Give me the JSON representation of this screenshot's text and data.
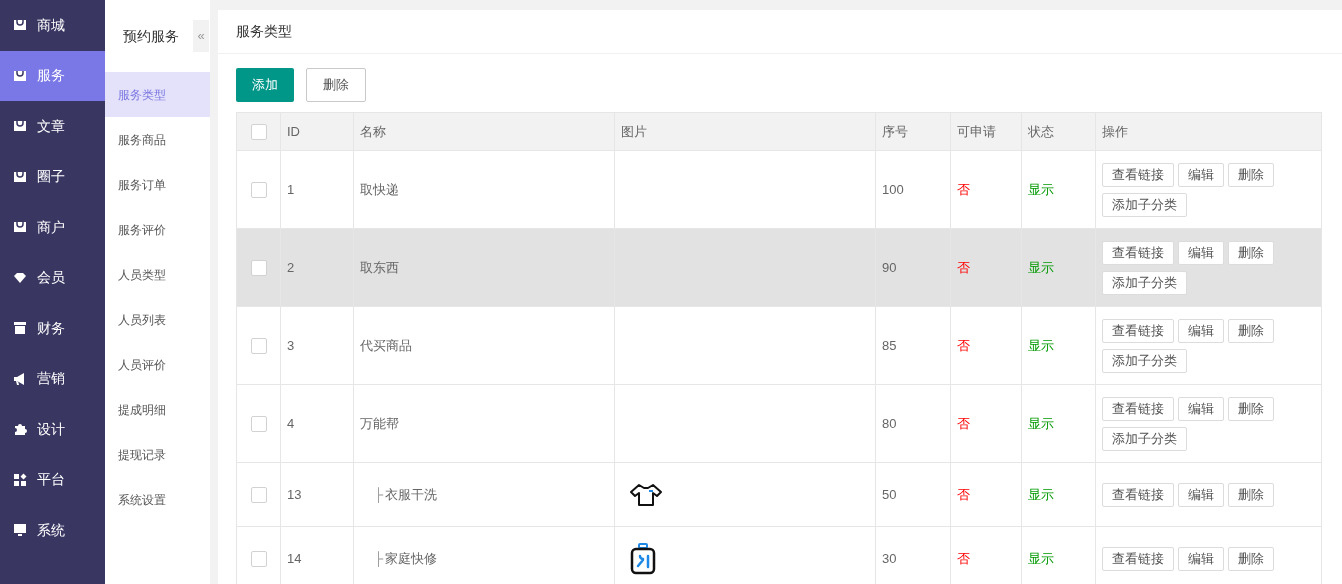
{
  "main_nav": [
    {
      "label": "商城",
      "kind": "bag",
      "selected": false
    },
    {
      "label": "服务",
      "kind": "bag",
      "selected": true
    },
    {
      "label": "文章",
      "kind": "bag",
      "selected": false
    },
    {
      "label": "圈子",
      "kind": "bag",
      "selected": false
    },
    {
      "label": "商户",
      "kind": "bag",
      "selected": false
    },
    {
      "label": "会员",
      "kind": "gem",
      "selected": false
    },
    {
      "label": "财务",
      "kind": "box",
      "selected": false
    },
    {
      "label": "营销",
      "kind": "megaphone",
      "selected": false
    },
    {
      "label": "设计",
      "kind": "puzzle",
      "selected": false
    },
    {
      "label": "平台",
      "kind": "grid",
      "selected": false
    },
    {
      "label": "系统",
      "kind": "monitor",
      "selected": false
    }
  ],
  "sub_nav": {
    "title": "预约服务",
    "collapse": "«",
    "items": [
      {
        "label": "服务类型",
        "selected": true
      },
      {
        "label": "服务商品",
        "selected": false
      },
      {
        "label": "服务订单",
        "selected": false
      },
      {
        "label": "服务评价",
        "selected": false
      },
      {
        "label": "人员类型",
        "selected": false
      },
      {
        "label": "人员列表",
        "selected": false
      },
      {
        "label": "人员评价",
        "selected": false
      },
      {
        "label": "提成明细",
        "selected": false
      },
      {
        "label": "提现记录",
        "selected": false
      },
      {
        "label": "系统设置",
        "selected": false
      }
    ]
  },
  "page_title": "服务类型",
  "toolbar": {
    "add": "添加",
    "delete": "删除"
  },
  "table": {
    "columns": [
      "ID",
      "名称",
      "图片",
      "序号",
      "可申请",
      "状态",
      "操作"
    ],
    "header_checked": false,
    "rows": [
      {
        "id": "1",
        "name": "取快递",
        "sort": "100",
        "applicable": "否",
        "status": "显示",
        "checked": false,
        "hovered": false,
        "actions": [
          "查看链接",
          "编辑",
          "删除",
          "添加子分类"
        ],
        "children": []
      },
      {
        "id": "2",
        "name": "取东西",
        "sort": "90",
        "applicable": "否",
        "status": "显示",
        "checked": false,
        "hovered": true,
        "actions": [
          "查看链接",
          "编辑",
          "删除",
          "添加子分类"
        ],
        "children": []
      },
      {
        "id": "3",
        "name": "代买商品",
        "sort": "85",
        "applicable": "否",
        "status": "显示",
        "checked": false,
        "hovered": false,
        "actions": [
          "查看链接",
          "编辑",
          "删除",
          "添加子分类"
        ],
        "children": []
      },
      {
        "id": "4",
        "name": "万能帮",
        "sort": "80",
        "applicable": "否",
        "status": "显示",
        "checked": false,
        "hovered": false,
        "actions": [
          "查看链接",
          "编辑",
          "删除",
          "添加子分类"
        ],
        "children": [
          {
            "id": "13",
            "prefix": "├",
            "name": "衣服干洗",
            "image": {
              "kind": "shirt"
            },
            "sort": "50",
            "applicable": "否",
            "status": "显示",
            "checked": false,
            "hovered": false,
            "actions": [
              "查看链接",
              "编辑",
              "删除"
            ]
          },
          {
            "id": "14",
            "prefix": "├",
            "name": "家庭快修",
            "image": {
              "kind": "toolkit"
            },
            "sort": "30",
            "applicable": "否",
            "status": "显示",
            "checked": false,
            "hovered": false,
            "actions": [
              "查看链接",
              "编辑",
              "删除"
            ]
          }
        ]
      }
    ]
  }
}
